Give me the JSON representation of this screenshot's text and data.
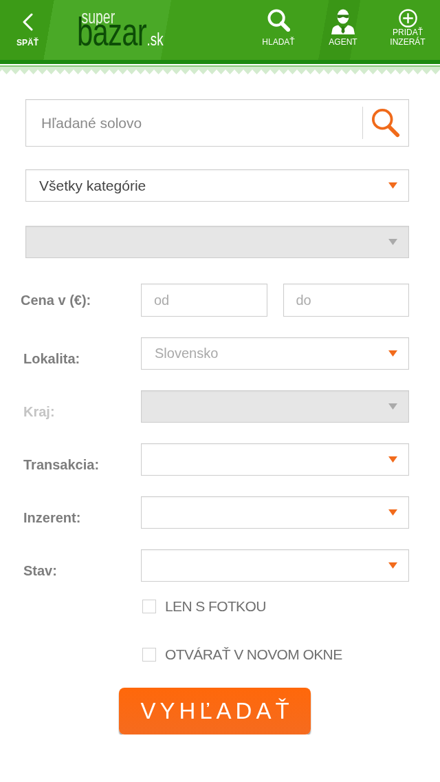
{
  "header": {
    "back": {
      "label": "SPÄŤ"
    },
    "logo": {
      "top": "super",
      "main": "bazar",
      "suffix": ".sk"
    },
    "actions": [
      {
        "kind": "search",
        "label": "HLADAŤ"
      },
      {
        "kind": "agent",
        "label": "AGENT"
      },
      {
        "kind": "add",
        "label": "PRIDAŤ INZERÁT"
      }
    ]
  },
  "search": {
    "placeholder": "Hľadané solovo"
  },
  "selects": [
    {
      "value": "Všetky kategórie",
      "disabled": false
    },
    {
      "disabled": true
    }
  ],
  "filters": [
    {
      "kind": "range",
      "label": "Cena v (€):",
      "disabled": false,
      "from_placeholder": "od",
      "to_placeholder": "do"
    },
    {
      "kind": "select",
      "label": "Lokalita:",
      "disabled": false,
      "placeholder": "Slovensko"
    },
    {
      "kind": "select",
      "label": "Kraj:",
      "disabled": true
    },
    {
      "kind": "select",
      "label": "Transakcia:",
      "disabled": false
    },
    {
      "kind": "select",
      "label": "Inzerent:",
      "disabled": false
    },
    {
      "kind": "select",
      "label": "Stav:",
      "disabled": false
    }
  ],
  "options": [
    {
      "label": "LEN S FOTKOU",
      "checked": false
    },
    {
      "label": "OTVÁRAŤ V NOVOM OKNE",
      "checked": false
    }
  ],
  "submit": {
    "label": "VYHĽADAŤ"
  }
}
